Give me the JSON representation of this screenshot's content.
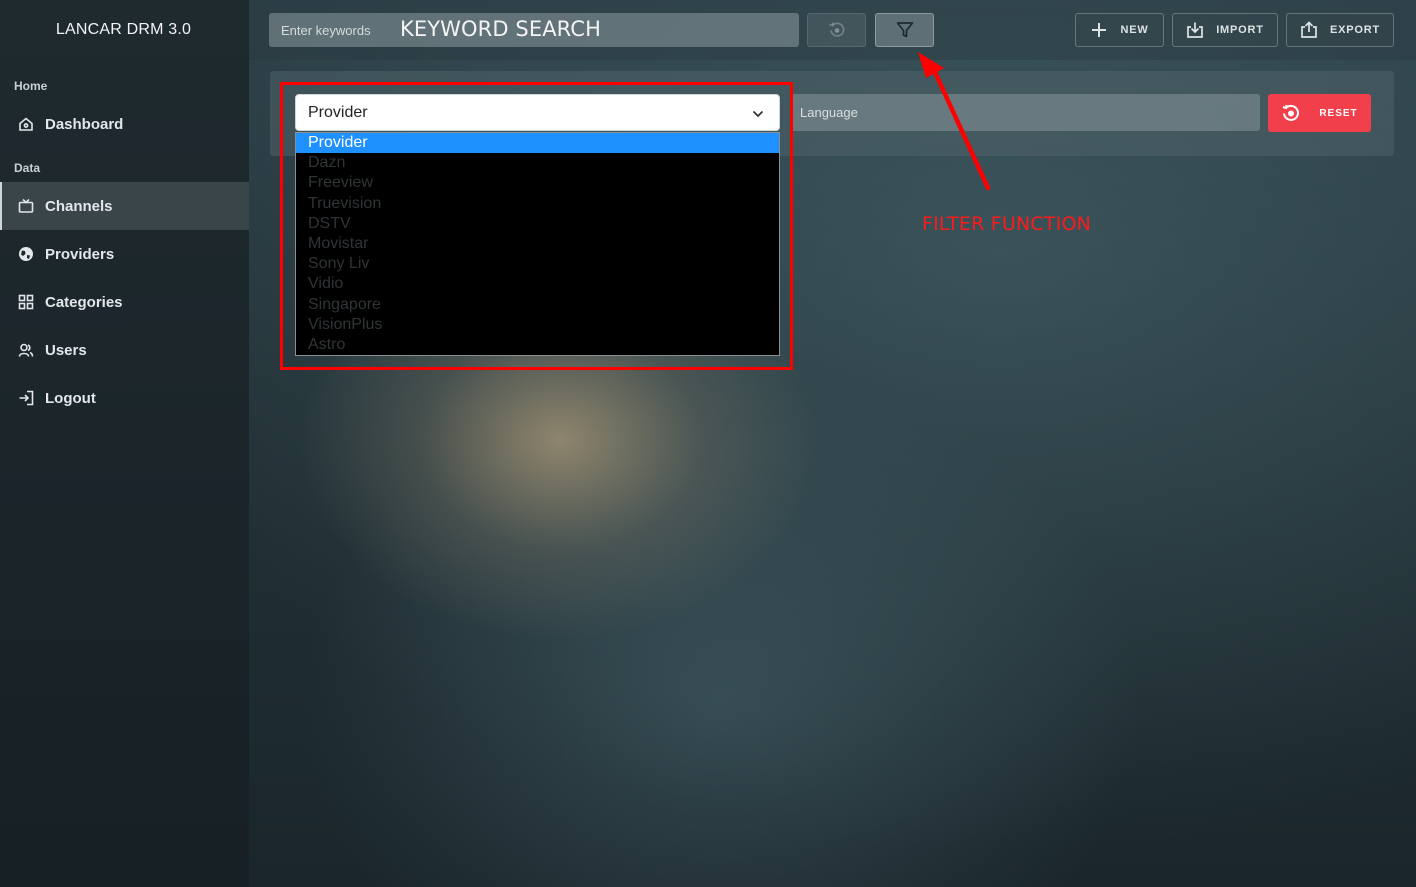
{
  "app": {
    "title": "LANCAR DRM 3.0"
  },
  "sidebar": {
    "sections": [
      {
        "label": "Home"
      },
      {
        "label": "Data"
      }
    ],
    "items": [
      {
        "label": "Dashboard",
        "icon": "home-icon"
      },
      {
        "label": "Channels",
        "icon": "tv-icon",
        "active": true
      },
      {
        "label": "Providers",
        "icon": "globe-icon"
      },
      {
        "label": "Categories",
        "icon": "grid-icon"
      },
      {
        "label": "Users",
        "icon": "users-icon"
      },
      {
        "label": "Logout",
        "icon": "logout-icon"
      }
    ]
  },
  "toolbar": {
    "search_placeholder": "Enter keywords",
    "new_label": "NEW",
    "import_label": "IMPORT",
    "export_label": "EXPORT"
  },
  "filters": {
    "provider_selected": "Provider",
    "provider_options": [
      "Provider",
      "Dazn",
      "Freeview",
      "Truevision",
      "DSTV",
      "Movistar",
      "Sony Liv",
      "Vidio",
      "Singapore",
      "VisionPlus",
      "Astro"
    ],
    "language_placeholder": "Language",
    "reset_label": "RESET"
  },
  "annotations": {
    "keyword_search": "KEYWORD SEARCH",
    "filter_function": "FILTER FUNCTION",
    "color": "#ff0000"
  },
  "colors": {
    "accent_reset": "#f13f4b",
    "dropdown_highlight": "#1e90ff"
  }
}
